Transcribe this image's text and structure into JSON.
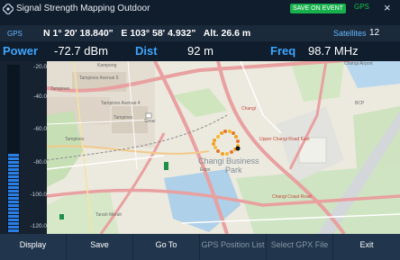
{
  "window": {
    "title": "Signal Strength Mapping Outdoor",
    "save_badge": "SAVE ON EVENT",
    "gps_status": "GPS",
    "close_glyph": "×"
  },
  "gps": {
    "label": "GPS",
    "latitude": "N 1° 20' 18.840\"",
    "longitude": "E 103° 58' 4.932\"",
    "altitude": "Alt. 26.6 m",
    "satellites_label": "Satellites",
    "satellites_count": "12"
  },
  "measurements": {
    "power_label": "Power",
    "power_value": "-72.7 dBm",
    "dist_label": "Dist",
    "dist_value": "92 m",
    "freq_label": "Freq",
    "freq_value": "98.7 MHz"
  },
  "level_bar": {
    "ticks": [
      "-20.0",
      "-40.0",
      "-60.0",
      "-80.0",
      "-100.0",
      "-120.0"
    ],
    "scale_min": -120,
    "scale_max": -20,
    "current_level_dbm": -72.7,
    "fill_color": "#2a7fe6"
  },
  "map": {
    "labels": {
      "kampong": "Kampong",
      "tampines_ave5": "Tampines Avenue 5",
      "tampines": "Tampines",
      "tampines2": "Tampines",
      "tampines3": "Tampines",
      "tampines_ave4": "Tampines Avenue 4",
      "changi_airport": "Changi Airport",
      "bcp": "BCP",
      "changi": "Changi",
      "changi_business": "Changi Business",
      "park": "Park",
      "simei": "Simei",
      "expo": "Expo",
      "tanah_merah": "Tanah Merah",
      "changi_coast": "Changi Coast Road",
      "upper_changi": "Upper Changi Road East"
    }
  },
  "softkeys": [
    {
      "label": "Display",
      "enabled": true
    },
    {
      "label": "Save",
      "enabled": true
    },
    {
      "label": "Go To",
      "enabled": true
    },
    {
      "label": "GPS Position List",
      "enabled": false
    },
    {
      "label": "Select GPX File",
      "enabled": false
    },
    {
      "label": "Exit",
      "enabled": true
    }
  ],
  "colors": {
    "accent_blue": "#3ea6ff",
    "save_green": "#18b04c",
    "background": "#1b2a3b"
  }
}
